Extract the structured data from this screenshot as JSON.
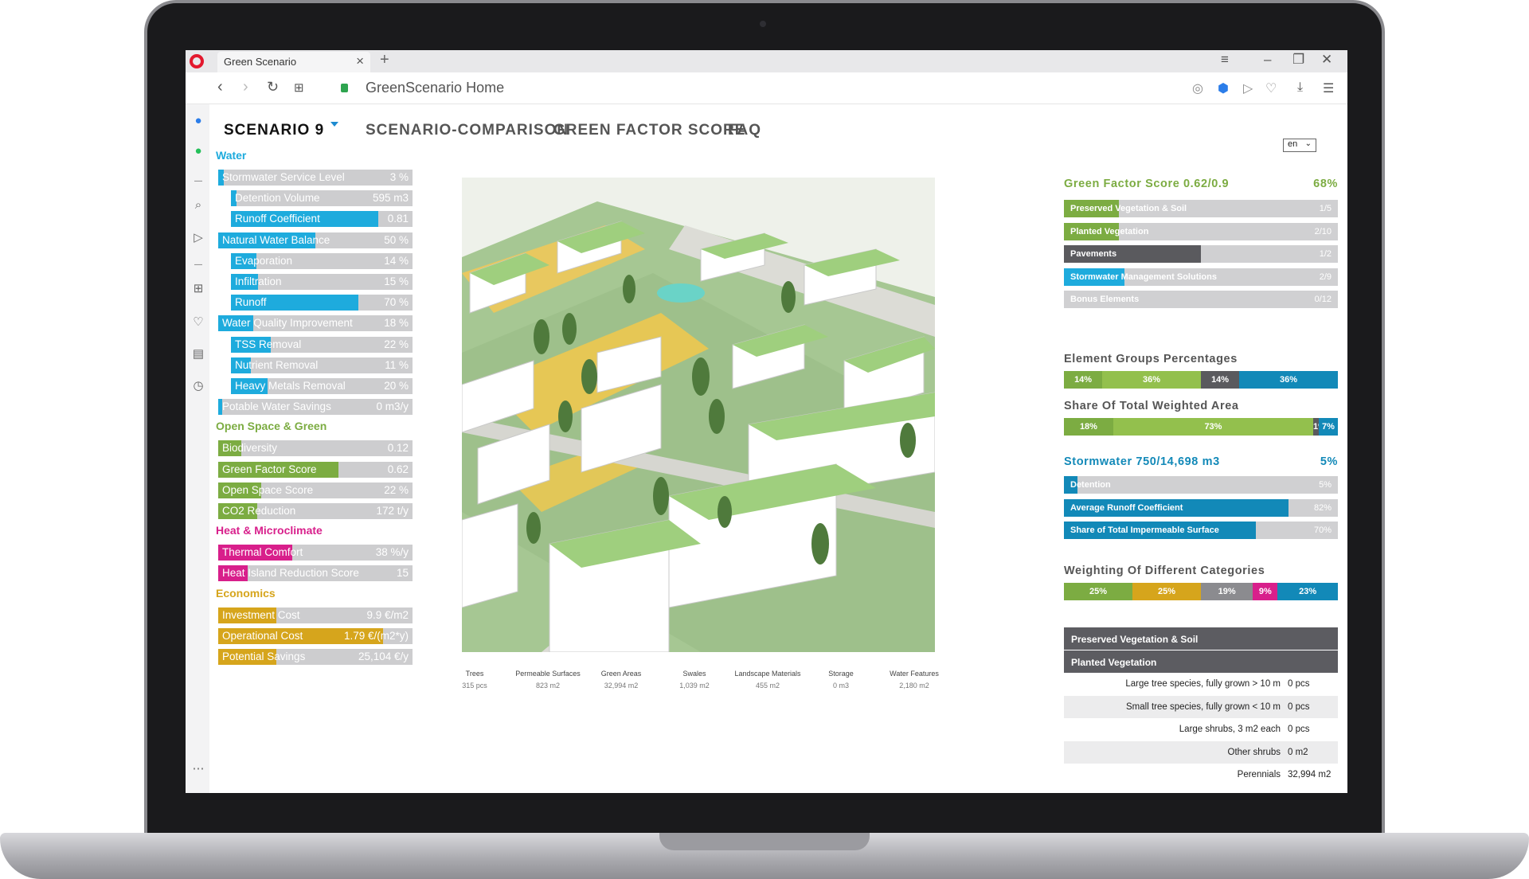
{
  "browser": {
    "tab_title": "Green Scenario",
    "url": "GreenScenario Home"
  },
  "nav": {
    "items": [
      "SCENARIO 9",
      "SCENARIO-COMPARISON",
      "GREEN FACTOR SCORE",
      "FAQ"
    ],
    "lang": "en"
  },
  "colors": {
    "water": "#1eabdd",
    "green": "#7cac42",
    "heat": "#d81f8b",
    "economics": "#d6a51c",
    "dark": "#5a5a5e"
  },
  "left_panel": {
    "sections": [
      {
        "title": "Water",
        "color": "#1eabdd",
        "rows": [
          {
            "label": "Stormwater Service Level",
            "value": "3 %",
            "fill": 0.03,
            "indent": false
          },
          {
            "label": "Detention Volume",
            "value": "595 m3",
            "fill": 0.03,
            "indent": true
          },
          {
            "label": "Runoff Coefficient",
            "value": "0.81",
            "fill": 0.81,
            "indent": true
          },
          {
            "label": "Natural Water Balance",
            "value": "50 %",
            "fill": 0.5,
            "indent": false
          },
          {
            "label": "Evaporation",
            "value": "14 %",
            "fill": 0.14,
            "indent": true
          },
          {
            "label": "Infiltration",
            "value": "15 %",
            "fill": 0.15,
            "indent": true
          },
          {
            "label": "Runoff",
            "value": "70 %",
            "fill": 0.7,
            "indent": true
          },
          {
            "label": "Water Quality Improvement",
            "value": "18 %",
            "fill": 0.18,
            "indent": false
          },
          {
            "label": "TSS Removal",
            "value": "22 %",
            "fill": 0.22,
            "indent": true
          },
          {
            "label": "Nutrient Removal",
            "value": "11 %",
            "fill": 0.11,
            "indent": true
          },
          {
            "label": "Heavy Metals Removal",
            "value": "20 %",
            "fill": 0.2,
            "indent": true
          },
          {
            "label": "Potable Water Savings",
            "value": "0 m3/y",
            "fill": 0.0,
            "indent": false
          }
        ]
      },
      {
        "title": "Open Space & Green",
        "color": "#7cac42",
        "rows": [
          {
            "label": "Biodiversity",
            "value": "0.12",
            "fill": 0.12,
            "indent": false
          },
          {
            "label": "Green Factor Score",
            "value": "0.62",
            "fill": 0.62,
            "indent": false
          },
          {
            "label": "Open Space Score",
            "value": "22 %",
            "fill": 0.22,
            "indent": false
          },
          {
            "label": "CO2 Reduction",
            "value": "172 t/y",
            "fill": 0.2,
            "indent": false
          }
        ]
      },
      {
        "title": "Heat & Microclimate",
        "color": "#d81f8b",
        "rows": [
          {
            "label": "Thermal Comfort",
            "value": "38 %/y",
            "fill": 0.38,
            "indent": false
          },
          {
            "label": "Heat Island Reduction Score",
            "value": "15",
            "fill": 0.15,
            "indent": false
          }
        ]
      },
      {
        "title": "Economics",
        "color": "#d6a51c",
        "rows": [
          {
            "label": "Investment Cost",
            "value": "9.9 €/m2",
            "fill": 0.3,
            "indent": false
          },
          {
            "label": "Operational Cost",
            "value": "1.79 €/(m2*y)",
            "fill": 0.85,
            "indent": false
          },
          {
            "label": "Potential Savings",
            "value": "25,104 €/y",
            "fill": 0.3,
            "indent": false
          }
        ]
      }
    ]
  },
  "legend": [
    {
      "name": "Trees",
      "value": "315 pcs"
    },
    {
      "name": "Permeable Surfaces",
      "value": "823 m2"
    },
    {
      "name": "Green Areas",
      "value": "32,994 m2"
    },
    {
      "name": "Swales",
      "value": "1,039 m2"
    },
    {
      "name": "Landscape Materials",
      "value": "455 m2"
    },
    {
      "name": "Storage",
      "value": "0 m3"
    },
    {
      "name": "Water Features",
      "value": "2,180 m2"
    }
  ],
  "right_panel": {
    "gfs": {
      "title": "Green Factor Score 0.62/0.9",
      "pct": "68%"
    },
    "gfs_bars": [
      {
        "label": "Preserved Vegetation & Soil",
        "value": "1/5",
        "fill": 0.2,
        "color": "#7cac42"
      },
      {
        "label": "Planted Vegetation",
        "value": "2/10",
        "fill": 0.2,
        "color": "#7cac42"
      },
      {
        "label": "Pavements",
        "value": "1/2",
        "fill": 0.5,
        "color": "#5a5a5e"
      },
      {
        "label": "Stormwater Management Solutions",
        "value": "2/9",
        "fill": 0.22,
        "color": "#1eabdd"
      },
      {
        "label": "Bonus Elements",
        "value": "0/12",
        "fill": 0.0,
        "color": "#7cac42"
      }
    ],
    "element_groups": {
      "title": "Element Groups Percentages",
      "segments": [
        {
          "label": "14%",
          "share": 0.14,
          "color": "#7cac42"
        },
        {
          "label": "36%",
          "share": 0.36,
          "color": "#93c04d"
        },
        {
          "label": "14%",
          "share": 0.14,
          "color": "#5a5a5e"
        },
        {
          "label": "36%",
          "share": 0.36,
          "color": "#1289b8"
        }
      ]
    },
    "weighted_area": {
      "title": "Share Of Total Weighted Area",
      "segments": [
        {
          "label": "18%",
          "share": 0.18,
          "color": "#7cac42"
        },
        {
          "label": "73%",
          "share": 0.73,
          "color": "#93c04d"
        },
        {
          "label": "1%",
          "share": 0.02,
          "color": "#5a5a5e"
        },
        {
          "label": "7%",
          "share": 0.07,
          "color": "#1289b8"
        }
      ]
    },
    "stormwater": {
      "title": "Stormwater 750/14,698 m3",
      "pct": "5%"
    },
    "stormwater_bars": [
      {
        "label": "Detention",
        "value": "5%",
        "fill": 0.05,
        "color": "#1289b8"
      },
      {
        "label": "Average Runoff Coefficient",
        "value": "82%",
        "fill": 0.82,
        "color": "#1289b8"
      },
      {
        "label": "Share of Total Impermeable Surface",
        "value": "70%",
        "fill": 0.7,
        "color": "#1289b8"
      }
    ],
    "weighting": {
      "title": "Weighting Of Different Categories",
      "segments": [
        {
          "label": "25%",
          "share": 0.25,
          "color": "#7cac42"
        },
        {
          "label": "25%",
          "share": 0.25,
          "color": "#d6a51c"
        },
        {
          "label": "19%",
          "share": 0.19,
          "color": "#8b8b8f"
        },
        {
          "label": "9%",
          "share": 0.09,
          "color": "#d81f8b"
        },
        {
          "label": "23%",
          "share": 0.22,
          "color": "#1289b8"
        }
      ]
    },
    "table": {
      "headers": [
        "Preserved Vegetation & Soil",
        "Planted Vegetation"
      ],
      "rows": [
        {
          "item": "Large tree species, fully grown > 10 m",
          "qty": "0 pcs"
        },
        {
          "item": "Small tree species, fully grown < 10 m",
          "qty": "0 pcs"
        },
        {
          "item": "Large shrubs, 3 m2 each",
          "qty": "0 pcs"
        },
        {
          "item": "Other shrubs",
          "qty": "0 m2"
        },
        {
          "item": "Perennials",
          "qty": "32,994 m2"
        }
      ]
    }
  }
}
